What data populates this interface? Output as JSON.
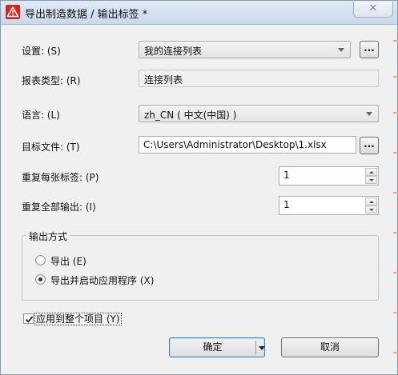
{
  "window": {
    "title": "导出制造数据 / 输出标签 *",
    "close_glyph": "✕"
  },
  "form": {
    "settings": {
      "label": "设置: (S)",
      "value": "我的连接列表",
      "browse_label": "..."
    },
    "report_type": {
      "label": "报表类型: (R)",
      "value": "连接列表"
    },
    "language": {
      "label": "语言: (L)",
      "value": "zh_CN ( 中文(中国) )"
    },
    "target_file": {
      "label": "目标文件: (T)",
      "value": "C:\\Users\\Administrator\\Desktop\\1.xlsx",
      "browse_label": "..."
    },
    "repeat_each": {
      "label": "重复每张标签: (P)",
      "value": "1"
    },
    "repeat_all": {
      "label": "重复全部输出: (I)",
      "value": "1"
    }
  },
  "output_mode": {
    "title": "输出方式",
    "options": [
      {
        "label": "导出 (E)",
        "checked": false
      },
      {
        "label": "导出并启动应用程序 (X)",
        "checked": true
      }
    ]
  },
  "apply_all": {
    "label": "应用到整个项目 (Y)",
    "checked": true
  },
  "buttons": {
    "ok": "确定",
    "cancel": "取消"
  },
  "colors": {
    "title_gradient_top": "#dfe9f5",
    "accent_border": "#3c7fb1",
    "icon_red": "#d9261c"
  },
  "icons": {
    "app": "warning-triangle-icon",
    "close": "close-icon",
    "dropdown": "chevron-down-icon"
  }
}
